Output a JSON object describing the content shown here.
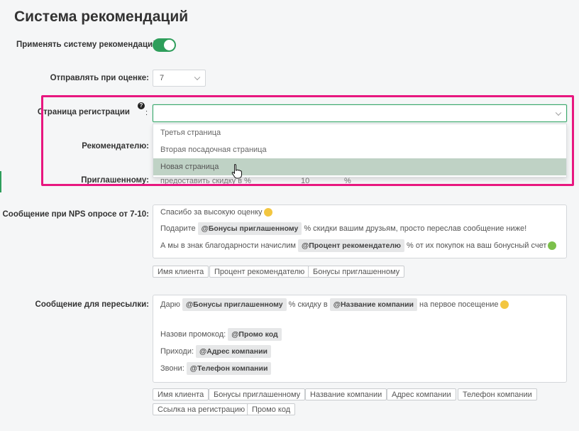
{
  "title": "Система рекомендаций",
  "apply": {
    "label": "Применять систему рекомендаций:",
    "enabled": true
  },
  "rating": {
    "label": "Отправлять при оценке:",
    "value": "7"
  },
  "registration": {
    "label": "Страница регистрации",
    "colon": ":",
    "help": "?",
    "value": "",
    "options": [
      "Третья страница",
      "Вторая посадочная страница",
      "Новая страница"
    ],
    "hovered_index": 2
  },
  "referrer": {
    "label": "Рекомендателю:"
  },
  "invited": {
    "label": "Приглашенному:",
    "type_value": "предоставить скидку в %",
    "amount": "10",
    "unit": "%"
  },
  "nps": {
    "label": "Сообщение при NPS опросе от 7-10:",
    "line1": "Спасибо за высокую оценку",
    "line2": {
      "before": "Подарите",
      "token": "@Бонусы приглашенному",
      "after": "% скидки вашим друзьям, просто переслав сообщение ниже!"
    },
    "line3": {
      "before": "А мы в знак благодарности начислим",
      "token": "@Процент рекомендателю",
      "after": "% от их покупок на ваш бонусный счет"
    },
    "chips": [
      "Имя клиента",
      "Процент рекомендателю",
      "Бонусы приглашенному"
    ]
  },
  "share": {
    "label": "Сообщение для пересылки:",
    "line1": {
      "before": "Дарю",
      "token1": "@Бонусы приглашенному",
      "mid": "% скидку в",
      "token2": "@Название компании",
      "after": "на первое посещение"
    },
    "promo": {
      "before": "Назови промокод:",
      "token": "@Промо код"
    },
    "address": {
      "before": "Приходи:",
      "token": "@Адрес компании"
    },
    "phone": {
      "before": "Звони:",
      "token": "@Телефон компании"
    },
    "chips": [
      "Имя клиента",
      "Бонусы приглашенному",
      "Название компании",
      "Адрес компании",
      "Телефон компании",
      "Ссылка на регистрацию",
      "Промо код"
    ]
  },
  "colors": {
    "accent": "#2e9e5b",
    "highlight": "#e8177f",
    "hover": "#bfd2c5"
  }
}
